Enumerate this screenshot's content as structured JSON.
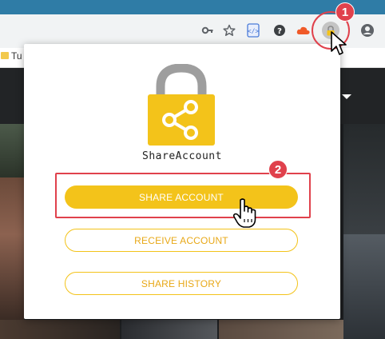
{
  "browser": {
    "bookmark_label": "Tu",
    "icons": [
      "key-icon",
      "star-icon",
      "code-extension-icon",
      "help-extension-icon",
      "cloud-extension-icon",
      "shareaccount-extension-icon",
      "profile-icon"
    ]
  },
  "popup": {
    "app_name": "ShareAccount",
    "buttons": {
      "share": "SHARE ACCOUNT",
      "receive": "RECEIVE ACCOUNT",
      "history": "SHARE HISTORY"
    }
  },
  "annotations": {
    "step1": "1",
    "step2": "2"
  },
  "colors": {
    "accent": "#f3c31a",
    "accent_text": "#e8a817",
    "highlight": "#e0414c",
    "lock_body": "#f3c31a",
    "lock_shackle": "#9e9e9e"
  }
}
